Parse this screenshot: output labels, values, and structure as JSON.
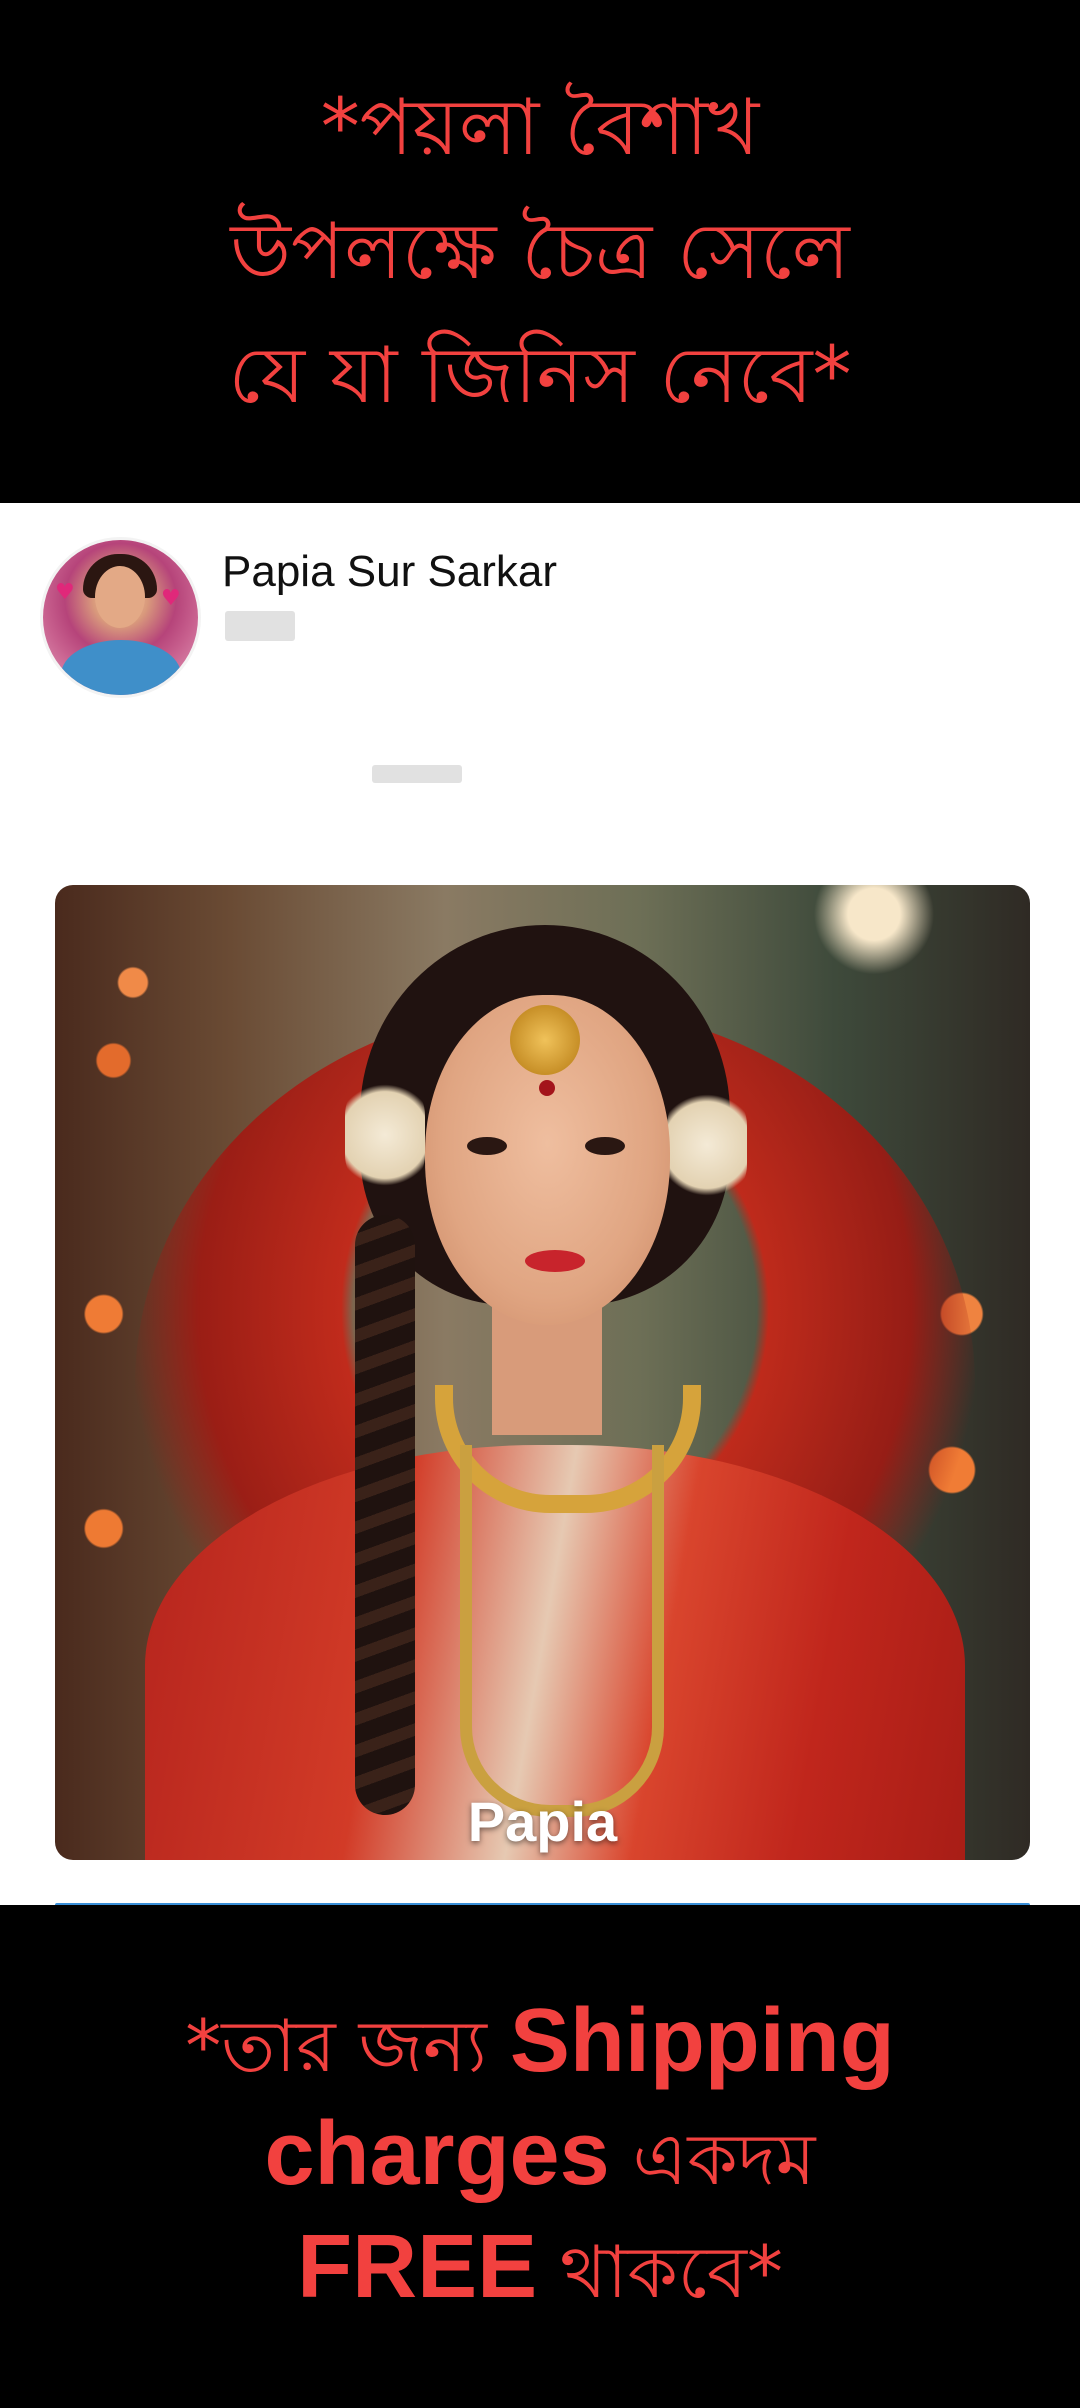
{
  "top_banner": {
    "line1": "*পয়লা বৈশাখ",
    "line2": "উপলক্ষে চৈত্র সেলে",
    "line3": "যে যা জিনিস নেবে*"
  },
  "post": {
    "author_name": "Papia Sur Sarkar",
    "photo_caption": "Papia"
  },
  "bottom_banner": {
    "line1_bn": "*তার জন্য ",
    "line1_en": "Shipping",
    "line2_en": "charges",
    "line2_bn": " একদম",
    "line3_en": "FREE",
    "line3_bn": " থাকবে*"
  },
  "colors": {
    "banner_text": "#f2413f",
    "banner_background": "#000000",
    "card_background": "#ffffff"
  }
}
